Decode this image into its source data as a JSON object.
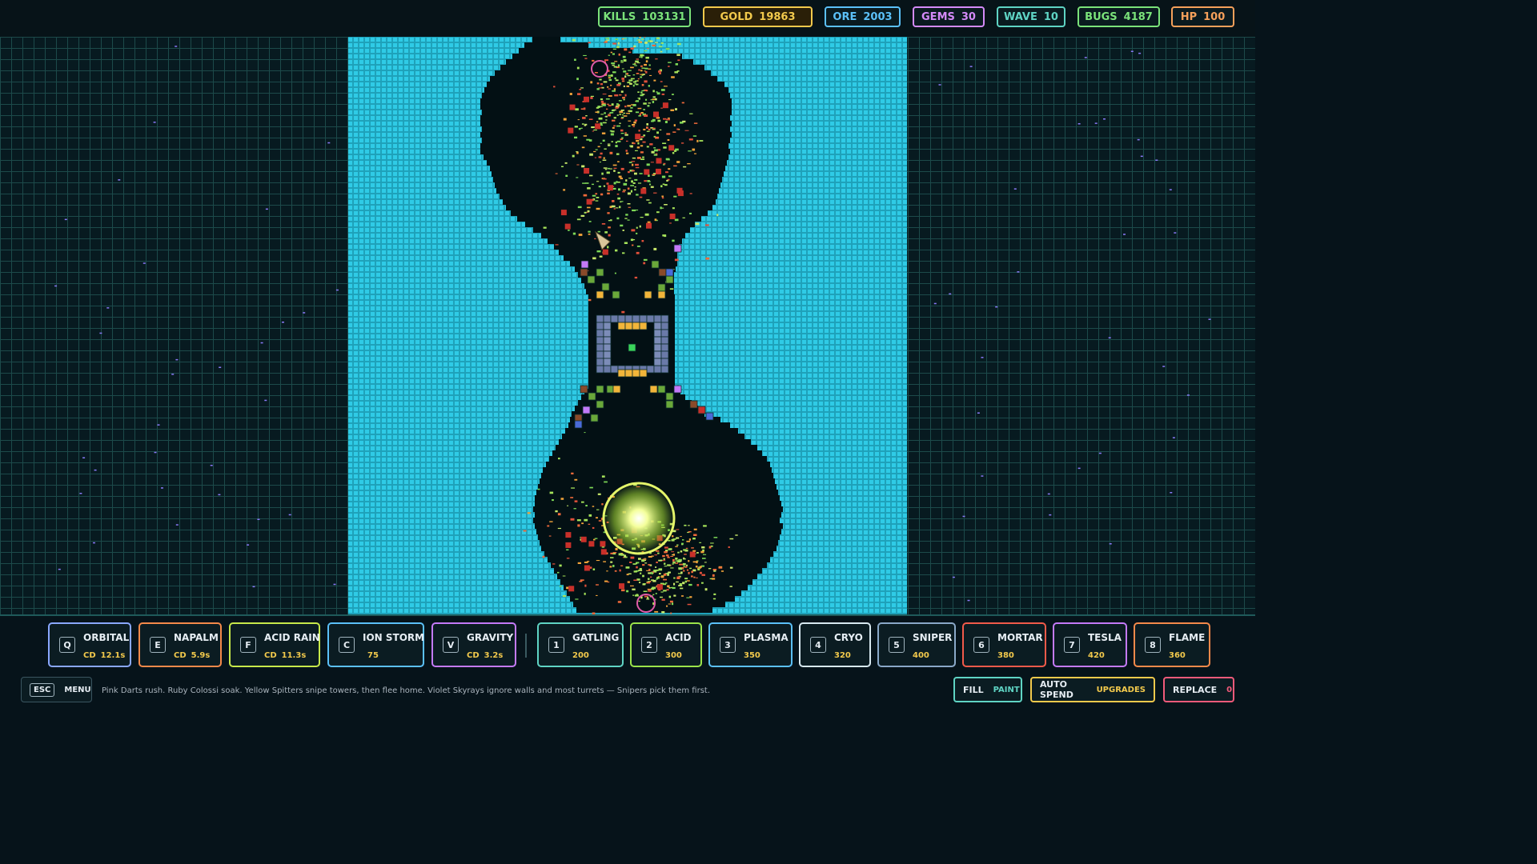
{
  "stats": [
    {
      "label": "KILLS",
      "value": "103131",
      "color": "#7be37a"
    },
    {
      "label": "GOLD",
      "value": "19863",
      "color": "#f2c94c"
    },
    {
      "label": "ORE",
      "value": "2003",
      "color": "#5bc0f8"
    },
    {
      "label": "GEMS",
      "value": "30",
      "color": "#d48af8"
    },
    {
      "label": "WAVE",
      "value": "10",
      "color": "#5fd4c4"
    },
    {
      "label": "BUGS",
      "value": "4187",
      "color": "#7be37a"
    },
    {
      "label": "HP",
      "value": "100",
      "color": "#f5a05a"
    }
  ],
  "abilities": [
    {
      "key": "Q",
      "name": "ORBITAL",
      "cd_label": "CD",
      "cd": "12.1s",
      "color": "#8aa8ff"
    },
    {
      "key": "E",
      "name": "NAPALM",
      "cd_label": "CD",
      "cd": "5.9s",
      "color": "#f5894a"
    },
    {
      "key": "F",
      "name": "ACID RAIN",
      "cd_label": "CD",
      "cd": "11.3s",
      "color": "#c7e84a"
    },
    {
      "key": "C",
      "name": "ION STORM",
      "cd_label": "",
      "cd": "75",
      "color": "#5bc0f8"
    },
    {
      "key": "V",
      "name": "GRAVITY",
      "cd_label": "CD",
      "cd": "3.2s",
      "color": "#c47af8"
    }
  ],
  "towers": [
    {
      "key": "1",
      "name": "GATLING",
      "cost": "200",
      "color": "#5fd4c4"
    },
    {
      "key": "2",
      "name": "ACID",
      "cost": "300",
      "color": "#9be34a"
    },
    {
      "key": "3",
      "name": "PLASMA",
      "cost": "350",
      "color": "#5bc0f8"
    },
    {
      "key": "4",
      "name": "CRYO",
      "cost": "320",
      "color": "#d8e8f0"
    },
    {
      "key": "5",
      "name": "SNIPER",
      "cost": "400",
      "color": "#8aa8c8"
    },
    {
      "key": "6",
      "name": "MORTAR",
      "cost": "380",
      "color": "#f25a4a"
    },
    {
      "key": "7",
      "name": "TESLA",
      "cost": "420",
      "color": "#c47af8"
    },
    {
      "key": "8",
      "name": "FLAME",
      "cost": "360",
      "color": "#f5894a"
    }
  ],
  "menu": {
    "key": "ESC",
    "label": "MENU"
  },
  "hint": "Pink Darts rush. Ruby Colossi soak. Yellow Spitters snipe towers, then flee home. Violet Skyrays ignore walls and most turrets — Snipers pick them first.",
  "controls": {
    "fill": {
      "label": "FILL",
      "value": "PAINT",
      "color": "#5fd4c4"
    },
    "autospend": {
      "label": "AUTO SPEND",
      "value": "UPGRADES",
      "color": "#f2c94c"
    },
    "replace": {
      "label": "REPLACE",
      "value": "0",
      "color": "#f25a7a"
    }
  },
  "colors": {
    "water": "#25c4e0",
    "dark": "#031014",
    "core": "#f4ff9a"
  }
}
